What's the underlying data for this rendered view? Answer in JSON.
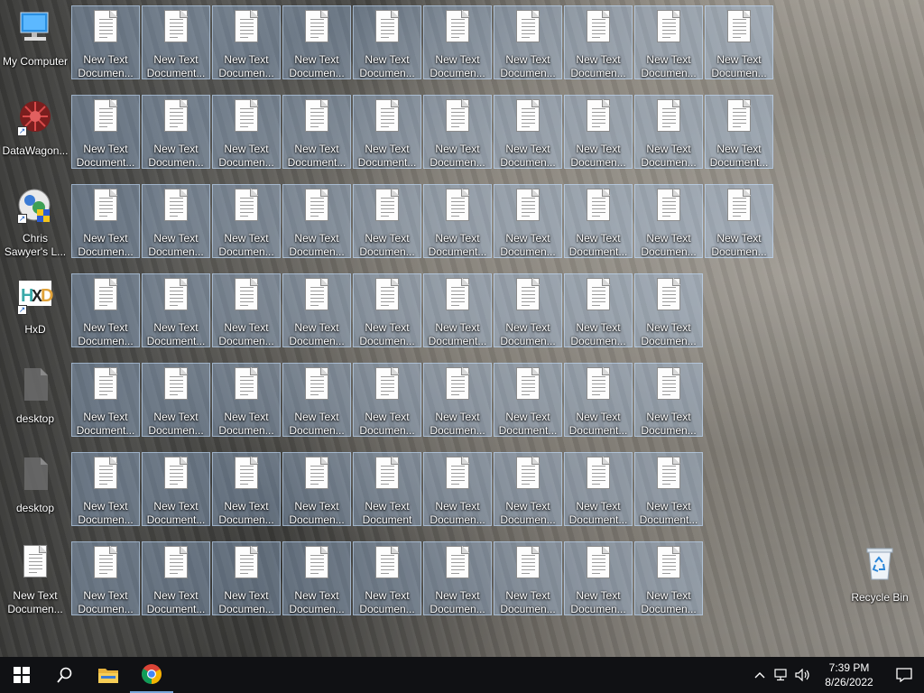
{
  "left_icons": [
    {
      "name": "my-computer-icon",
      "label": "My Computer",
      "kind": "computer"
    },
    {
      "name": "datawagon-icon",
      "label": "DataWagon...",
      "kind": "datawagon",
      "shortcut": true
    },
    {
      "name": "chris-sawyers-icon",
      "label": "Chris\nSawyer's L...",
      "kind": "rct",
      "shortcut": true
    },
    {
      "name": "hxd-icon",
      "label": "HxD",
      "kind": "hxd",
      "shortcut": true
    },
    {
      "name": "desktop-file-1-icon",
      "label": "desktop",
      "kind": "blank"
    },
    {
      "name": "desktop-file-2-icon",
      "label": "desktop",
      "kind": "blank"
    },
    {
      "name": "new-text-document-left-icon",
      "label": "New Text\nDocumen...",
      "kind": "doc"
    }
  ],
  "grid_rows": [
    {
      "count": 10,
      "labels": [
        "New Text\nDocumen...",
        "New Text\nDocument...",
        "New Text\nDocumen...",
        "New Text\nDocumen...",
        "New Text\nDocumen...",
        "New Text\nDocumen...",
        "New Text\nDocumen...",
        "New Text\nDocumen...",
        "New Text\nDocumen...",
        "New Text\nDocumen..."
      ]
    },
    {
      "count": 10,
      "labels": [
        "New Text\nDocument...",
        "New Text\nDocumen...",
        "New Text\nDocumen...",
        "New Text\nDocument...",
        "New Text\nDocument...",
        "New Text\nDocumen...",
        "New Text\nDocumen...",
        "New Text\nDocumen...",
        "New Text\nDocumen...",
        "New Text\nDocument..."
      ]
    },
    {
      "count": 10,
      "labels": [
        "New Text\nDocumen...",
        "New Text\nDocumen...",
        "New Text\nDocumen...",
        "New Text\nDocumen...",
        "New Text\nDocumen...",
        "New Text\nDocument...",
        "New Text\nDocumen...",
        "New Text\nDocument...",
        "New Text\nDocumen...",
        "New Text\nDocumen..."
      ]
    },
    {
      "count": 9,
      "labels": [
        "New Text\nDocumen...",
        "New Text\nDocument...",
        "New Text\nDocumen...",
        "New Text\nDocumen...",
        "New Text\nDocumen...",
        "New Text\nDocument...",
        "New Text\nDocumen...",
        "New Text\nDocumen...",
        "New Text\nDocumen..."
      ]
    },
    {
      "count": 9,
      "labels": [
        "New Text\nDocument...",
        "New Text\nDocumen...",
        "New Text\nDocumen...",
        "New Text\nDocumen...",
        "New Text\nDocumen...",
        "New Text\nDocumen...",
        "New Text\nDocument...",
        "New Text\nDocument...",
        "New Text\nDocumen..."
      ]
    },
    {
      "count": 9,
      "labels": [
        "New Text\nDocumen...",
        "New Text\nDocument...",
        "New Text\nDocumen...",
        "New Text\nDocumen...",
        "New Text\nDocument",
        "New Text\nDocumen...",
        "New Text\nDocumen...",
        "New Text\nDocument...",
        "New Text\nDocument..."
      ]
    },
    {
      "count": 9,
      "labels": [
        "New Text\nDocumen...",
        "New Text\nDocument...",
        "New Text\nDocumen...",
        "New Text\nDocumen...",
        "New Text\nDocumen...",
        "New Text\nDocumen...",
        "New Text\nDocumen...",
        "New Text\nDocumen...",
        "New Text\nDocumen..."
      ]
    }
  ],
  "recycle_bin": {
    "label": "Recycle Bin"
  },
  "taskbar": {
    "items": [
      {
        "name": "start-button",
        "icon": "windows-logo-icon"
      },
      {
        "name": "search-button",
        "icon": "search-icon"
      },
      {
        "name": "file-explorer-button",
        "icon": "folder-icon"
      },
      {
        "name": "chrome-button",
        "icon": "chrome-icon",
        "active": true
      }
    ],
    "tray": {
      "chevron": "^",
      "time": "7:39 PM",
      "date": "8/26/2022"
    }
  }
}
